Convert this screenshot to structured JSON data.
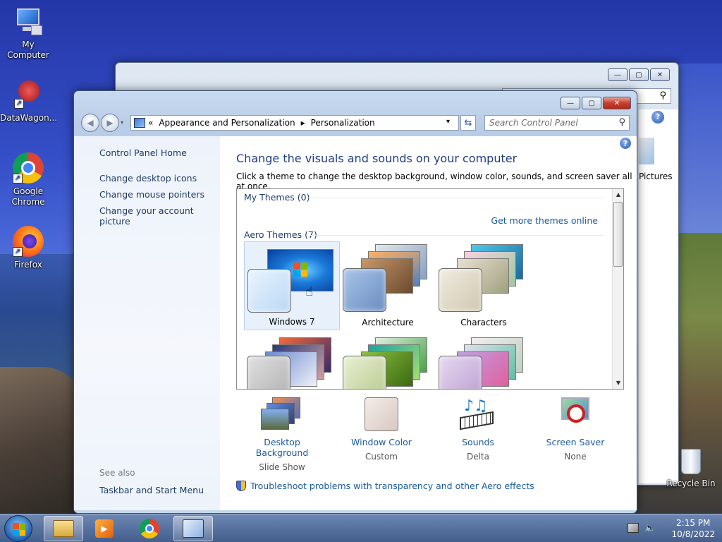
{
  "desktop": {
    "icons": [
      {
        "label": "My Computer"
      },
      {
        "label": "DataWagon..."
      },
      {
        "label": "Google Chrome"
      },
      {
        "label": "Firefox"
      },
      {
        "label": "Recycle Bin"
      }
    ],
    "background_window": {
      "peek_label": "Pictures"
    }
  },
  "window": {
    "caption_buttons": {
      "minimize": "—",
      "maximize": "▢",
      "close": "✕"
    },
    "nav": {
      "back": "◀",
      "forward": "▶"
    },
    "address": {
      "overflow": "«",
      "crumbs": [
        "Appearance and Personalization",
        "Personalization"
      ],
      "sep": "▸",
      "dropdown": "▾"
    },
    "search": {
      "placeholder": "Search Control Panel"
    },
    "left_pane": {
      "home": "Control Panel Home",
      "links": [
        "Change desktop icons",
        "Change mouse pointers",
        "Change your account picture"
      ],
      "see_also_heading": "See also",
      "see_also_links": [
        "Taskbar and Start Menu"
      ]
    },
    "main": {
      "help": "?",
      "title": "Change the visuals and sounds on your computer",
      "subtitle": "Click a theme to change the desktop background, window color, sounds, and screen saver all at once.",
      "groups": {
        "my_themes": "My Themes (0)",
        "get_more": "Get more themes online",
        "aero_themes": "Aero Themes (7)"
      },
      "themes": [
        {
          "label": "Windows 7",
          "selected": true
        },
        {
          "label": "Architecture",
          "selected": false
        },
        {
          "label": "Characters",
          "selected": false
        },
        {
          "label": "",
          "selected": false
        },
        {
          "label": "",
          "selected": false
        },
        {
          "label": "",
          "selected": false
        }
      ],
      "bottom": [
        {
          "label": "Desktop Background",
          "value": "Slide Show"
        },
        {
          "label": "Window Color",
          "value": "Custom"
        },
        {
          "label": "Sounds",
          "value": "Delta"
        },
        {
          "label": "Screen Saver",
          "value": "None"
        }
      ],
      "troubleshoot": "Troubleshoot problems with transparency and other Aero effects"
    }
  },
  "taskbar": {
    "time": "2:15 PM",
    "date": "10/8/2022"
  },
  "colors": {
    "link": "#1a5aa0",
    "title": "#1e3c86",
    "close": "#c84030"
  }
}
